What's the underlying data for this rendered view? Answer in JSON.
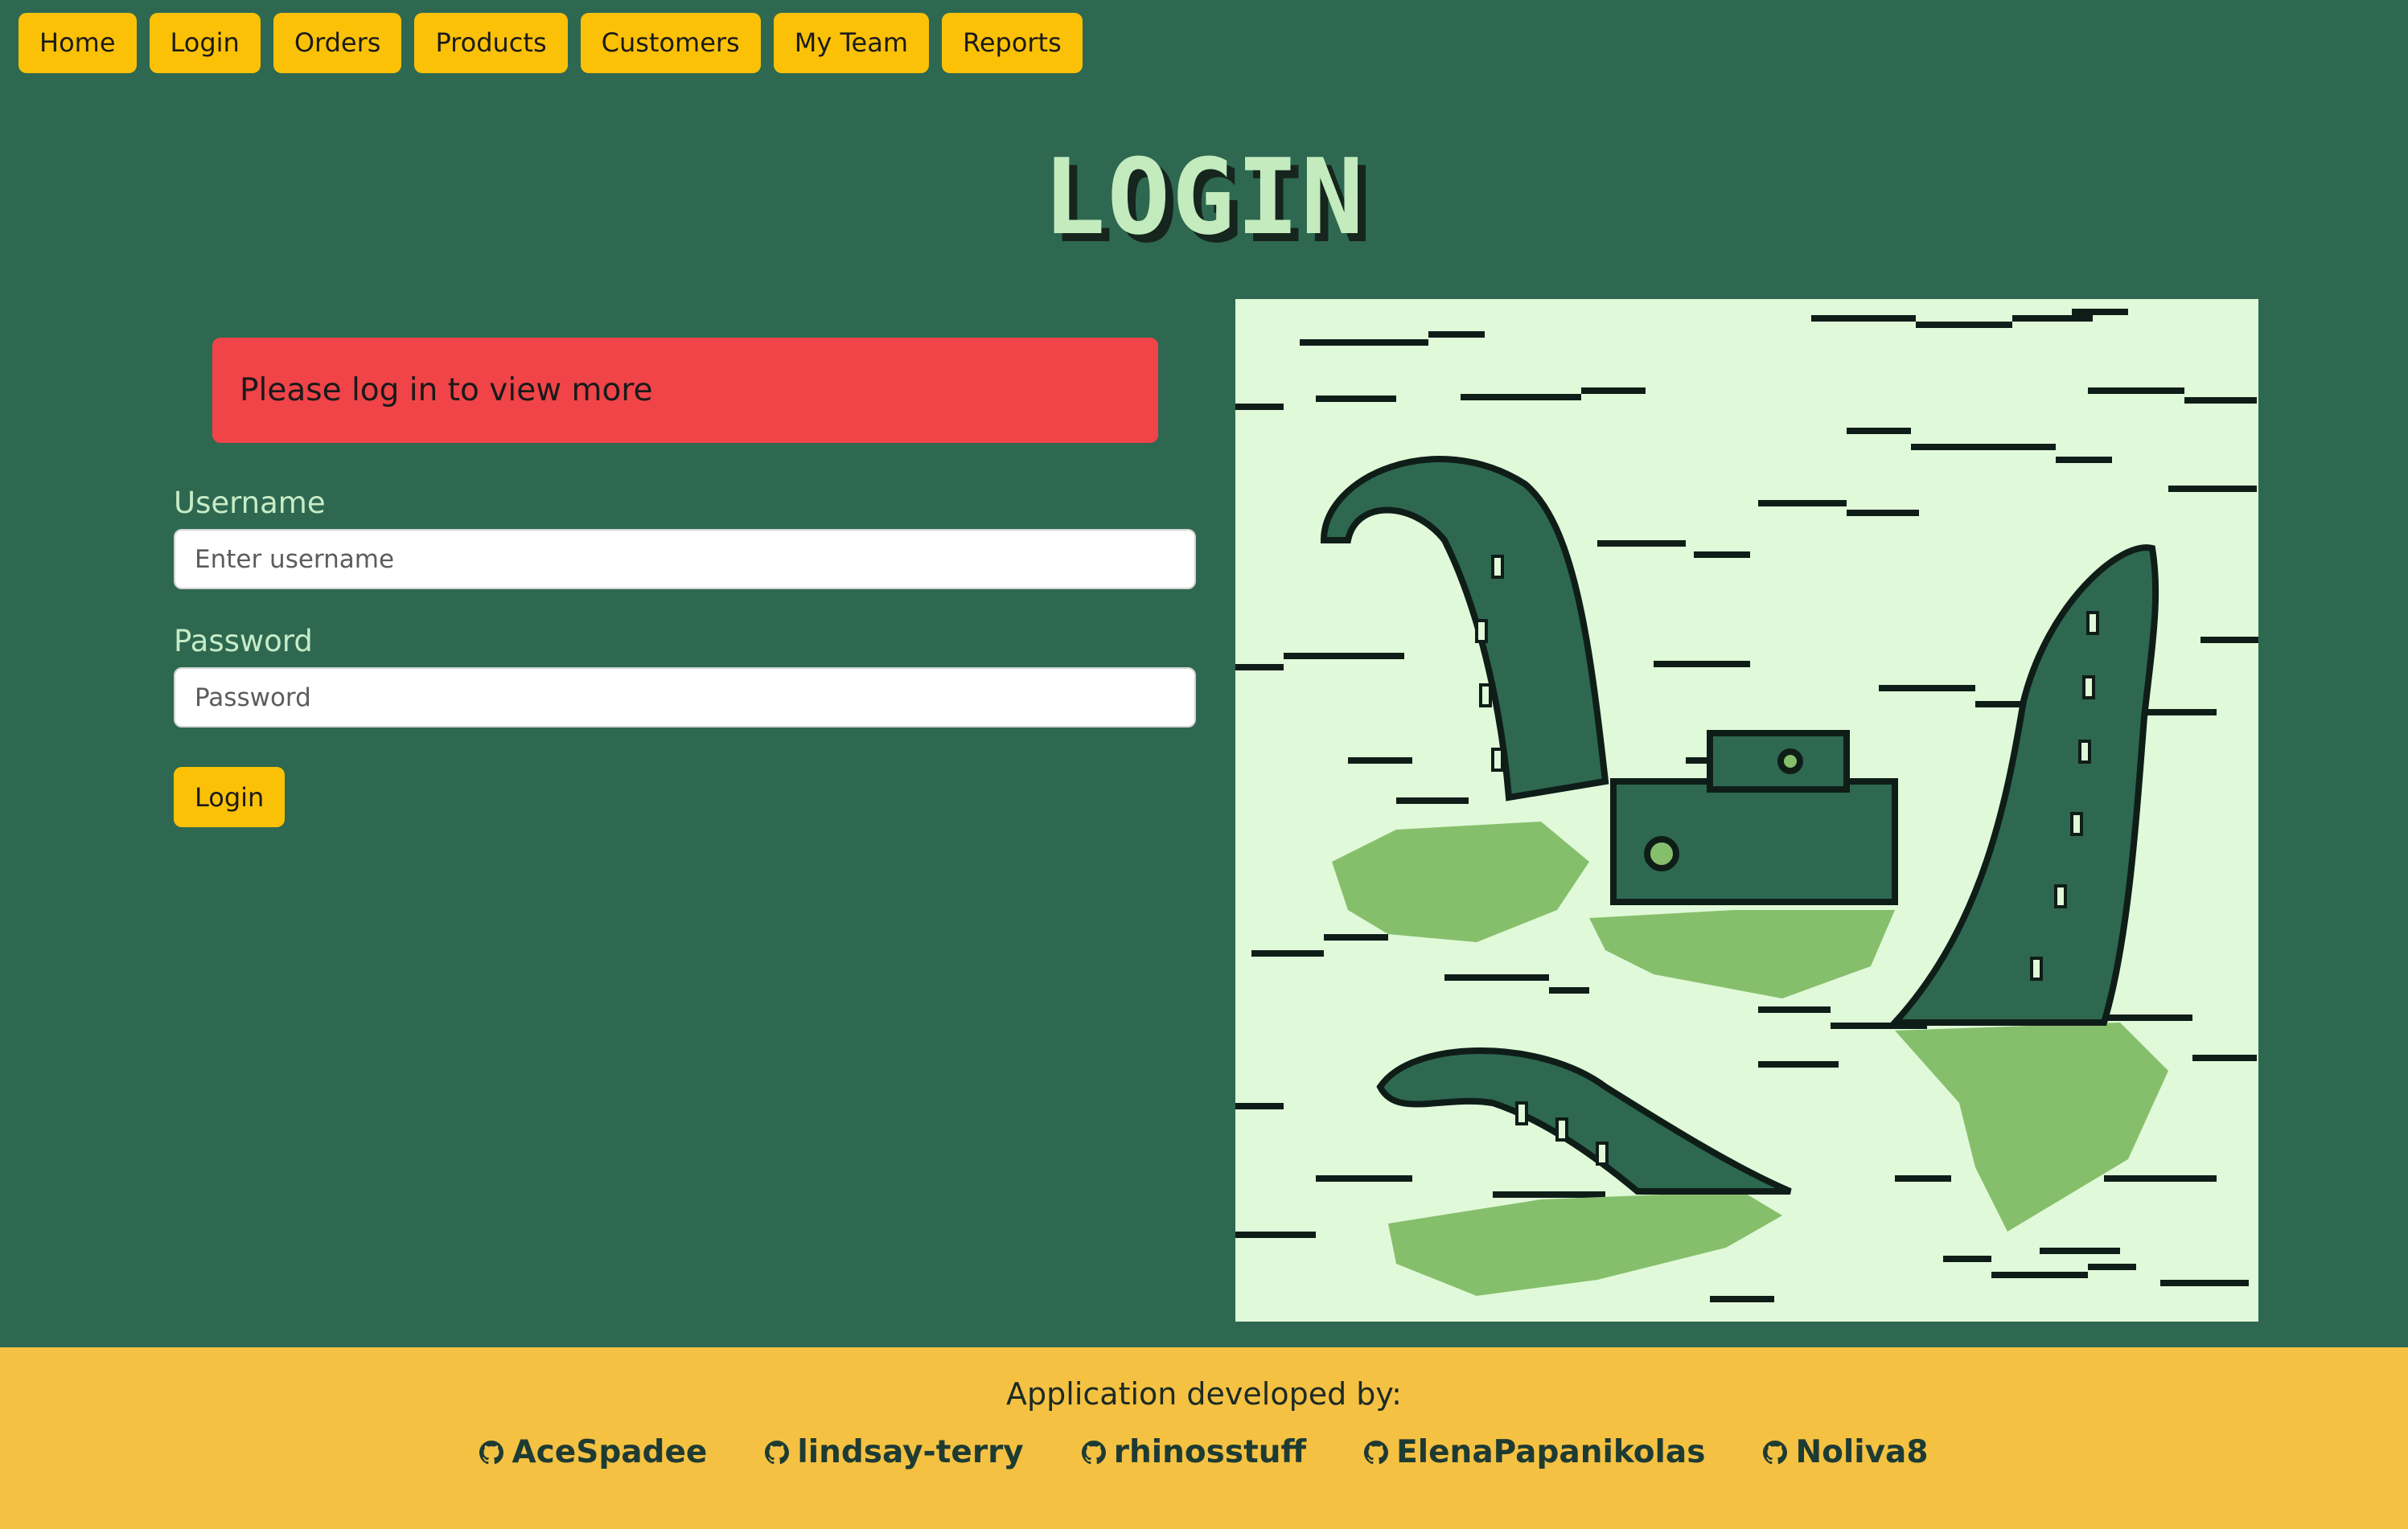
{
  "nav": {
    "items": [
      {
        "label": "Home"
      },
      {
        "label": "Login"
      },
      {
        "label": "Orders"
      },
      {
        "label": "Products"
      },
      {
        "label": "Customers"
      },
      {
        "label": "My Team"
      },
      {
        "label": "Reports"
      }
    ]
  },
  "page": {
    "title": "LOGIN"
  },
  "alert": {
    "message": "Please log in to view more",
    "color": "#f04448"
  },
  "form": {
    "username_label": "Username",
    "username_placeholder": "Enter username",
    "username_value": "",
    "password_label": "Password",
    "password_placeholder": "Password",
    "password_value": "",
    "submit_label": "Login"
  },
  "illustration": {
    "subject": "kraken-tentacles-pixel-art",
    "colors": [
      "#e0f9d8",
      "#86bf6c",
      "#2e6851",
      "#0f1d18"
    ]
  },
  "footer": {
    "title": "Application developed by:",
    "developers": [
      {
        "name": "AceSpadee",
        "icon": "github-icon"
      },
      {
        "name": "lindsay-terry",
        "icon": "github-icon"
      },
      {
        "name": "rhinosstuff",
        "icon": "github-icon"
      },
      {
        "name": "ElenaPapanikolas",
        "icon": "github-icon"
      },
      {
        "name": "Noliva8",
        "icon": "github-icon"
      }
    ]
  },
  "theme": {
    "background": "#2e6851",
    "accent": "#fbc107",
    "footer": "#f4c142",
    "title": "#c3ebbd"
  }
}
